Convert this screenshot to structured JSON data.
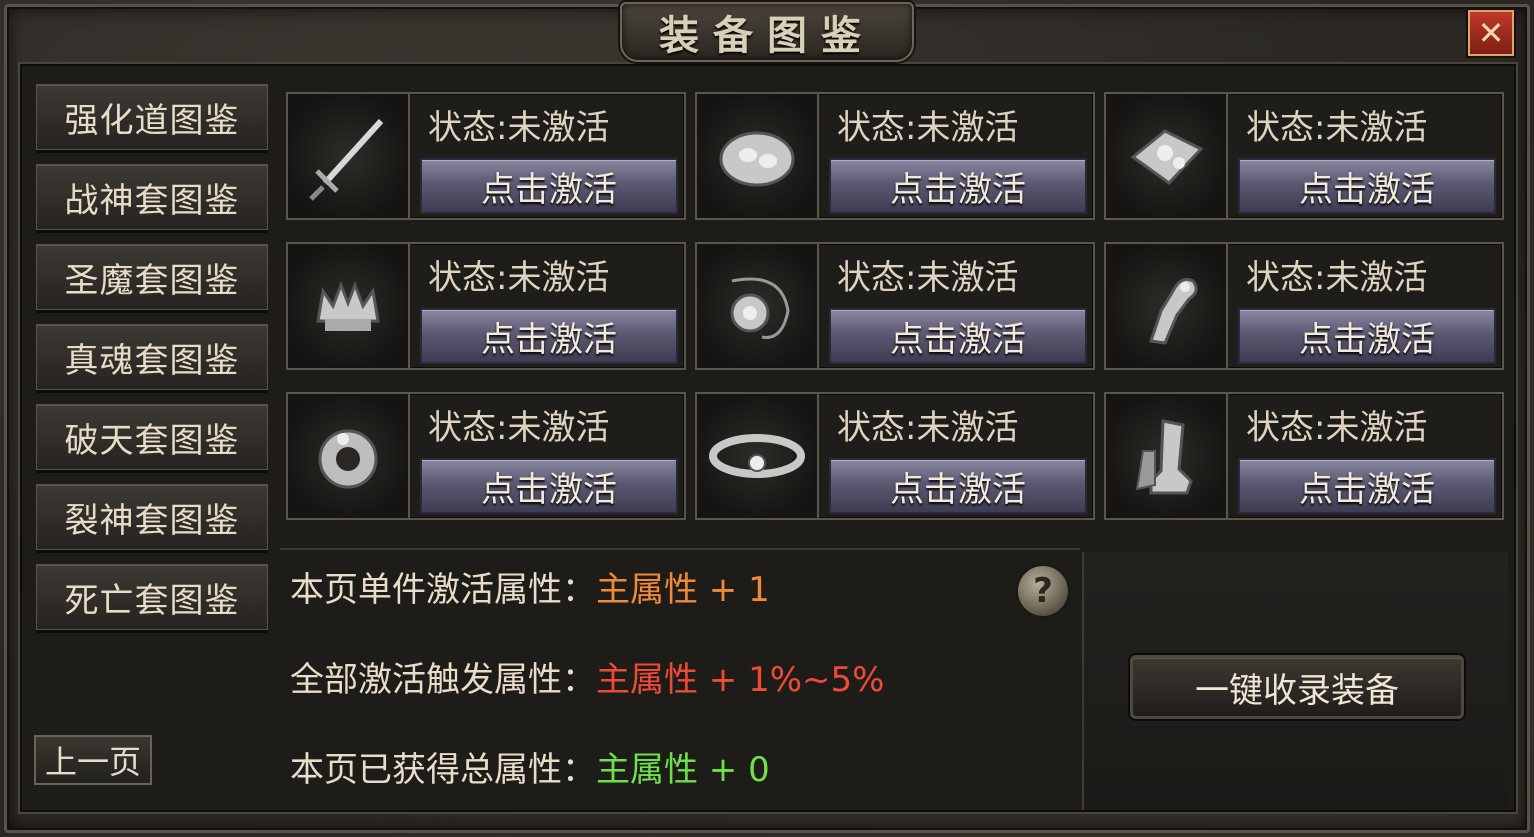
{
  "window": {
    "title": "装备图鉴",
    "close_label": "✕"
  },
  "sidebar": {
    "items": [
      {
        "label": "强化道图鉴"
      },
      {
        "label": "战神套图鉴"
      },
      {
        "label": "圣魔套图鉴"
      },
      {
        "label": "真魂套图鉴"
      },
      {
        "label": "破天套图鉴"
      },
      {
        "label": "裂神套图鉴"
      },
      {
        "label": "死亡套图鉴"
      }
    ],
    "prev_page_label": "上一页"
  },
  "equipment": [
    {
      "item": "sword-icon",
      "status": "状态:未激活",
      "button": "点击激活"
    },
    {
      "item": "armor-icon",
      "status": "状态:未激活",
      "button": "点击激活"
    },
    {
      "item": "armor-alt-icon",
      "status": "状态:未激活",
      "button": "点击激活"
    },
    {
      "item": "helmet-icon",
      "status": "状态:未激活",
      "button": "点击激活"
    },
    {
      "item": "necklace-icon",
      "status": "状态:未激活",
      "button": "点击激活"
    },
    {
      "item": "bracelet-icon",
      "status": "状态:未激活",
      "button": "点击激活"
    },
    {
      "item": "ring-icon",
      "status": "状态:未激活",
      "button": "点击激活"
    },
    {
      "item": "belt-icon",
      "status": "状态:未激活",
      "button": "点击激活"
    },
    {
      "item": "boots-icon",
      "status": "状态:未激活",
      "button": "点击激活"
    }
  ],
  "attributes": {
    "single": {
      "label": "本页单件激活属性：",
      "value": "主属性 + 1",
      "color": "#f0893a"
    },
    "all": {
      "label": "全部激活触发属性：",
      "value": "主属性 +  1%~5%",
      "color": "#ef4a36"
    },
    "total": {
      "label": "本页已获得总属性：",
      "value": "主属性 + 0",
      "color": "#6ee04a"
    }
  },
  "help_label": "?",
  "collect_button_label": "一键收录装备"
}
